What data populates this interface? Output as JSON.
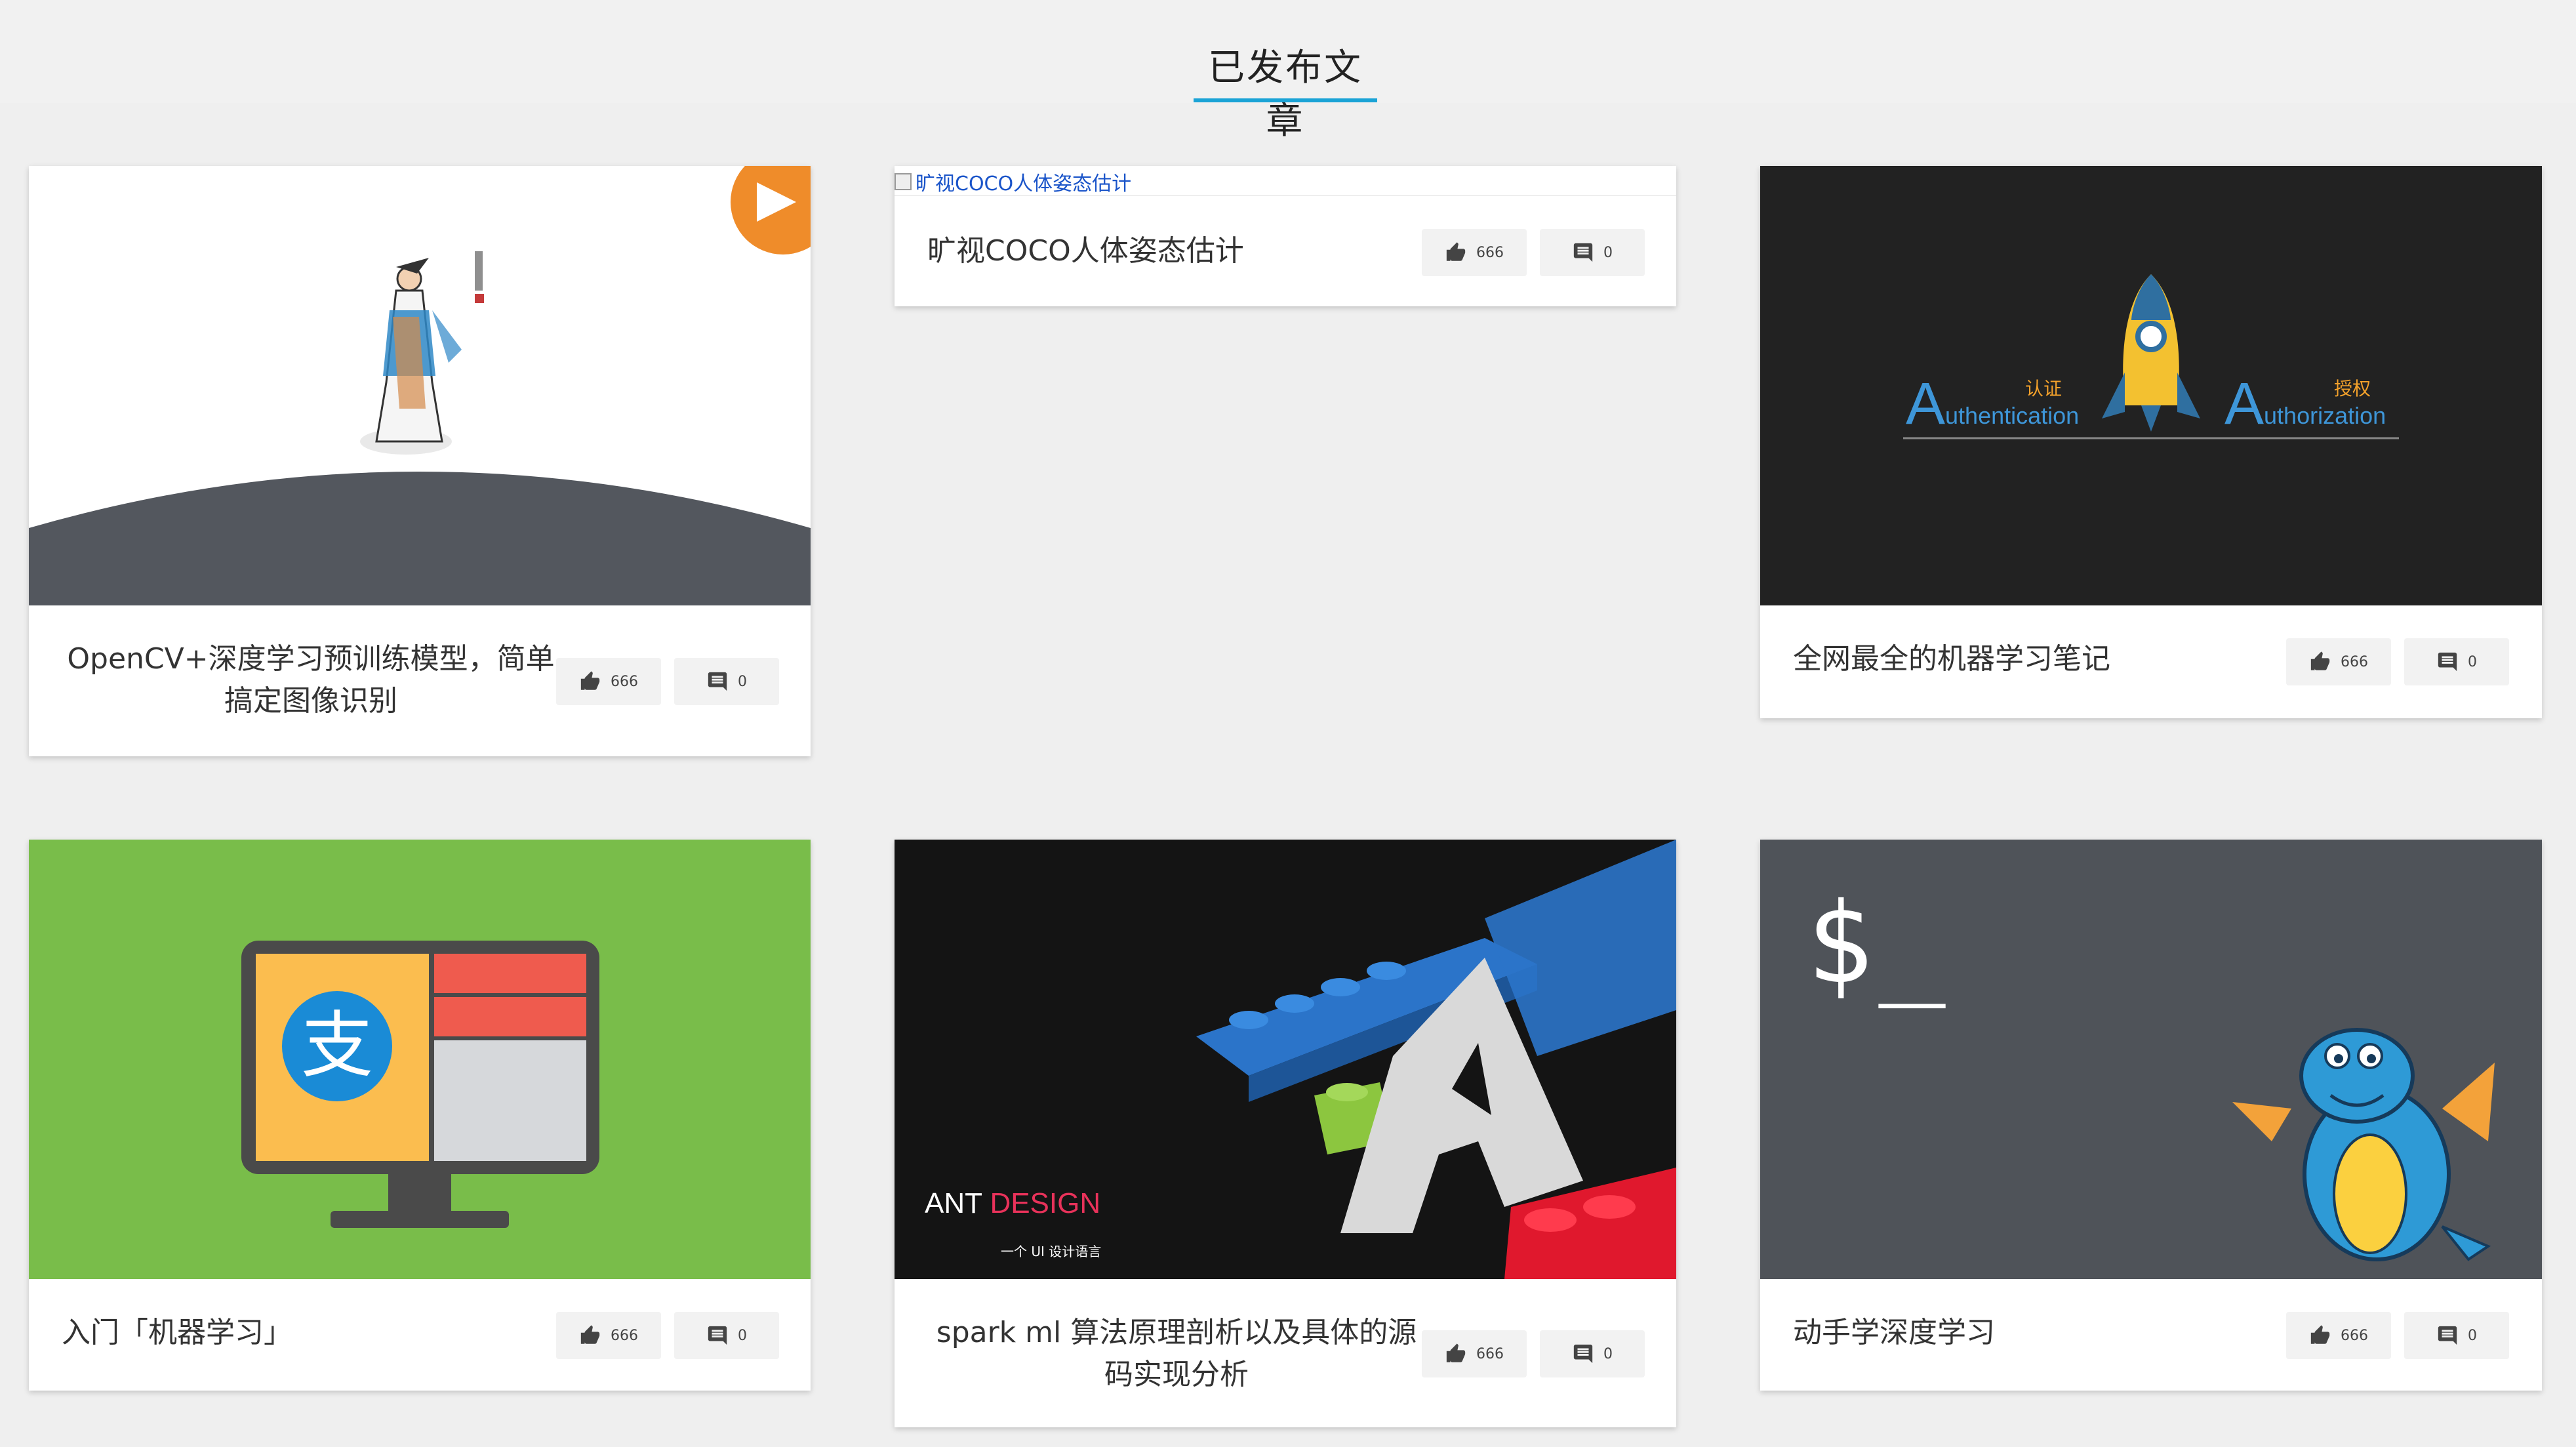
{
  "page": {
    "title": "已发布文章"
  },
  "cards": [
    {
      "title": "OpenCV+深度学习预训练模型，简单搞定图像识别",
      "title_line1": "OpenCV+深度学习预训练模型，简单",
      "title_line2": "搞定图像识别",
      "likes": "666",
      "comments": "0",
      "cover_icon": "calligraphy-figure-on-planet"
    },
    {
      "title": "旷视COCO人体姿态估计",
      "cover_alt": "旷视COCO人体姿态估计",
      "likes": "666",
      "comments": "0",
      "cover_icon": "broken-image-icon"
    },
    {
      "title": "全网最全的机器学习笔记",
      "likes": "666",
      "comments": "0",
      "cover_icon": "rocket-auth-banner",
      "cover_text": {
        "auth_cn": "认证",
        "authz_cn": "授权",
        "auth_en_cap": "A",
        "auth_en_rest": "uthentication",
        "authz_en_cap": "A",
        "authz_en_rest": "uthorization"
      }
    },
    {
      "title": "入门「机器学习」",
      "likes": "666",
      "comments": "0",
      "cover_icon": "alipay-monitor-illustration"
    },
    {
      "title": "spark ml 算法原理剖析以及具体的源码实现分析",
      "title_line1": "spark ml 算法原理剖析以及具体的源",
      "title_line2": "码实现分析",
      "likes": "666",
      "comments": "0",
      "cover_icon": "ant-design-lego-banner",
      "cover_text": {
        "brand_a": "ANT ",
        "brand_b": "DESIGN",
        "tagline": "一个 UI 设计语言"
      }
    },
    {
      "title": "动手学深度学习",
      "likes": "666",
      "comments": "0",
      "cover_icon": "terminal-dragon-banner",
      "cover_text": {
        "prompt": "$_"
      }
    }
  ],
  "colors": {
    "accent_underline": "#1aa3d6",
    "orange_play": "#ef8c2a",
    "green_banner": "#79bd4a",
    "dark_banner": "#222222",
    "terminal_bg": "#4f5359",
    "ant_design_red": "#e8325a"
  }
}
